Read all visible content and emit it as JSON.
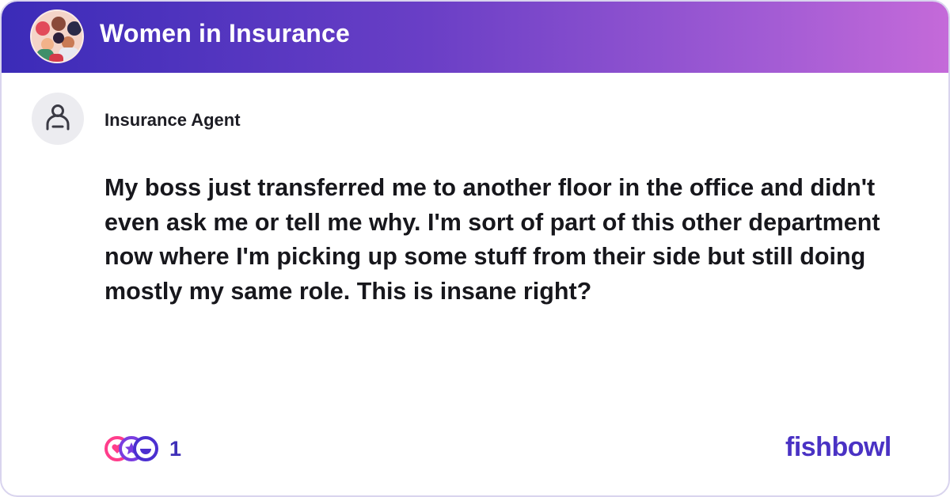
{
  "header": {
    "bowl_title": "Women in Insurance",
    "gradient_colors": [
      "#3b2bb8",
      "#6a3fc6",
      "#a15bd4",
      "#c56ad9"
    ]
  },
  "author": {
    "name": "Insurance Agent",
    "avatar_icon": "person-icon"
  },
  "post": {
    "text": "My boss just transferred me to another floor in the office and didn't even ask me or tell me why. I'm sort of part of this other department now where I'm picking up some stuff from their side but still doing mostly my same role. This is insane right?"
  },
  "reactions": {
    "count": "1",
    "icons": [
      "heart-reaction-icon",
      "star-reaction-icon",
      "laugh-reaction-icon"
    ]
  },
  "brand": {
    "logo_text": "fishbowl",
    "color": "#4a32c4"
  }
}
